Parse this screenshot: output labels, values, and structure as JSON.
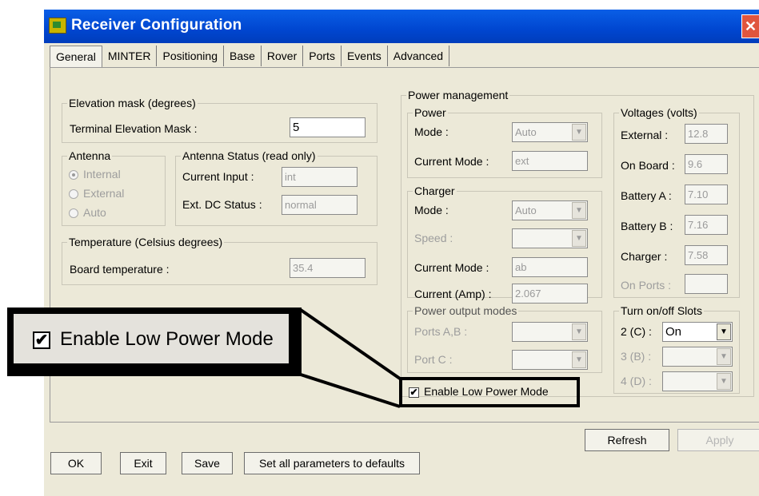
{
  "window": {
    "title": "Receiver Configuration",
    "close_glyph": "✕"
  },
  "tabs": [
    "General",
    "MINTER",
    "Positioning",
    "Base",
    "Rover",
    "Ports",
    "Events",
    "Advanced"
  ],
  "elevation": {
    "legend": "Elevation mask (degrees)",
    "label": "Terminal Elevation Mask :",
    "value": "5"
  },
  "antenna": {
    "legend": "Antenna",
    "options": [
      "Internal",
      "External",
      "Auto"
    ],
    "selected": "Internal"
  },
  "antenna_status": {
    "legend": "Antenna Status (read only)",
    "current_input_label": "Current Input :",
    "current_input_value": "int",
    "ext_dc_label": "Ext. DC Status :",
    "ext_dc_value": "normal"
  },
  "temperature": {
    "legend": "Temperature (Celsius degrees)",
    "label": "Board temperature :",
    "value": "35.4"
  },
  "power_management": {
    "legend": "Power management",
    "power": {
      "legend": "Power",
      "mode_label": "Mode :",
      "mode_value": "Auto",
      "current_mode_label": "Current Mode :",
      "current_mode_value": "ext"
    },
    "charger": {
      "legend": "Charger",
      "mode_label": "Mode :",
      "mode_value": "Auto",
      "speed_label": "Speed :",
      "speed_value": "",
      "current_mode_label": "Current Mode :",
      "current_mode_value": "ab",
      "current_amp_label": "Current (Amp) :",
      "current_amp_value": "2.067"
    },
    "output_modes": {
      "legend": "Power output modes",
      "ports_ab_label": "Ports A,B :",
      "port_c_label": "Port C :"
    },
    "enable_low_power_label": "Enable Low Power Mode",
    "enable_low_power_checked": true
  },
  "voltages": {
    "legend": "Voltages (volts)",
    "external_label": "External :",
    "external_value": "12.8",
    "onboard_label": "On Board :",
    "onboard_value": "9.6",
    "battery_a_label": "Battery A :",
    "battery_a_value": "7.10",
    "battery_b_label": "Battery B :",
    "battery_b_value": "7.16",
    "charger_label": "Charger :",
    "charger_value": "7.58",
    "onports_label": "On Ports :",
    "onports_value": ""
  },
  "slots": {
    "legend": "Turn on/off Slots",
    "slot2_label": "2 (C) :",
    "slot2_value": "On",
    "slot3_label": "3 (B) :",
    "slot4_label": "4 (D) :"
  },
  "buttons": {
    "refresh": "Refresh",
    "apply": "Apply",
    "ok": "OK",
    "exit": "Exit",
    "save": "Save",
    "defaults": "Set all parameters to defaults"
  },
  "callout": {
    "label": "Enable Low Power Mode",
    "check_glyph": "✔"
  },
  "icons": {
    "arrow": "▼",
    "check": "✔"
  }
}
